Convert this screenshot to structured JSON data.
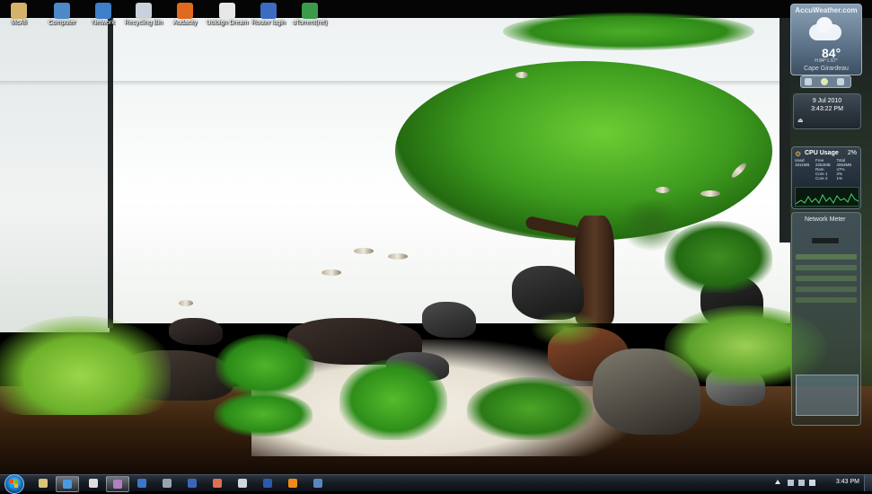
{
  "desktop_icons": [
    {
      "name": "mcafee-shortcut-icon",
      "label": "McAfi",
      "color": "#d4b26a"
    },
    {
      "name": "computer-icon",
      "label": "Computer",
      "color": "#4d88c8"
    },
    {
      "name": "network-icon",
      "label": "Network",
      "color": "#3d7fc9"
    },
    {
      "name": "recycling-bin-icon",
      "label": "Recycling Bin",
      "color": "#c9d2da"
    },
    {
      "name": "audacity-icon",
      "label": "Audacity",
      "color": "#e06a1f"
    },
    {
      "name": "utorrent-icon",
      "label": "Uoloign Dream",
      "color": "#e7e7e7"
    },
    {
      "name": "router-login-icon",
      "label": "Router login",
      "color": "#3a6cc2"
    },
    {
      "name": "utorrent-green-icon",
      "label": "uTorrent(ret)",
      "color": "#3a9c4a"
    }
  ],
  "weather": {
    "brand": "AccuWeather.com",
    "temp": "84°",
    "hi_lo": "H 84°   L 67°",
    "city": "Cape Girardeau"
  },
  "clock_gadget": {
    "date": "9 Jul 2010",
    "time": "3:43:22 PM"
  },
  "cpu_gadget": {
    "title": "CPU Usage",
    "percent": "2%",
    "rows": [
      [
        "Used",
        "Free",
        "Total"
      ],
      [
        "1811MB",
        "2252MB",
        "4063MB"
      ],
      [
        "",
        "Ram",
        "47%"
      ],
      [
        "",
        "Core 1",
        "2%"
      ],
      [
        "",
        "Core 2",
        "1%"
      ]
    ]
  },
  "network_gadget": {
    "title": "Network Meter"
  },
  "taskbar": {
    "buttons": [
      {
        "name": "taskbar-explorer-button",
        "color": "#d9c47a",
        "active": false
      },
      {
        "name": "taskbar-chrome-button",
        "color": "#4a9ae0",
        "active": true
      },
      {
        "name": "taskbar-notepad-button",
        "color": "#dddddd",
        "active": false
      },
      {
        "name": "taskbar-media-button",
        "color": "#b080c0",
        "active": true
      },
      {
        "name": "taskbar-globe-button",
        "color": "#3c76c4",
        "active": false
      },
      {
        "name": "taskbar-steam-button",
        "color": "#9aa4b0",
        "active": false
      },
      {
        "name": "taskbar-word-button",
        "color": "#3a66b8",
        "active": false
      },
      {
        "name": "taskbar-paint-button",
        "color": "#e07050",
        "active": false
      },
      {
        "name": "taskbar-calculator-button",
        "color": "#cfd6de",
        "active": false
      },
      {
        "name": "taskbar-photoshop-button",
        "color": "#2b5aa8",
        "active": false
      },
      {
        "name": "taskbar-vlc-button",
        "color": "#f08a1c",
        "active": false
      },
      {
        "name": "taskbar-network-button",
        "color": "#5a86c0",
        "active": false
      }
    ],
    "clock": "3:43 PM"
  }
}
